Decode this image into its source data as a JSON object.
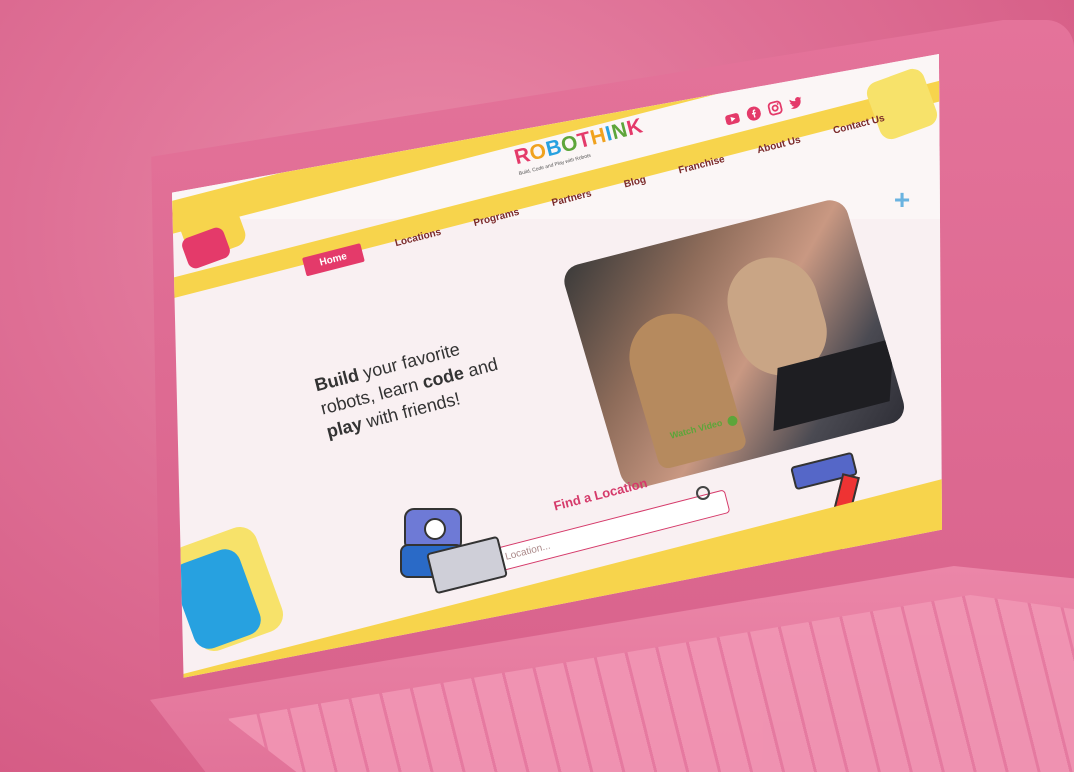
{
  "brand": {
    "logo_text": "ROBOTHINK",
    "tagline": "Build, Code and Play with Robots"
  },
  "social": [
    "youtube-icon",
    "facebook-icon",
    "instagram-icon",
    "twitter-icon"
  ],
  "nav": {
    "items": [
      "Home",
      "Locations",
      "Programs",
      "Partners",
      "Blog",
      "Franchise",
      "About Us",
      "Contact Us"
    ],
    "active": "Home"
  },
  "hero": {
    "line1_bold": "Build",
    "line1_rest": " your favorite",
    "line2_start": "robots, learn ",
    "line2_bold": "code",
    "line2_end": " and",
    "line3_bold": "play",
    "line3_rest": " with friends!"
  },
  "video": {
    "label": "Watch Video"
  },
  "locator": {
    "title": "Find a Location",
    "placeholder": "Location..."
  },
  "colors": {
    "accent_pink": "#e43a6a",
    "accent_yellow": "#f7d44c",
    "accent_blue": "#27a1e0",
    "green": "#5da53a"
  }
}
